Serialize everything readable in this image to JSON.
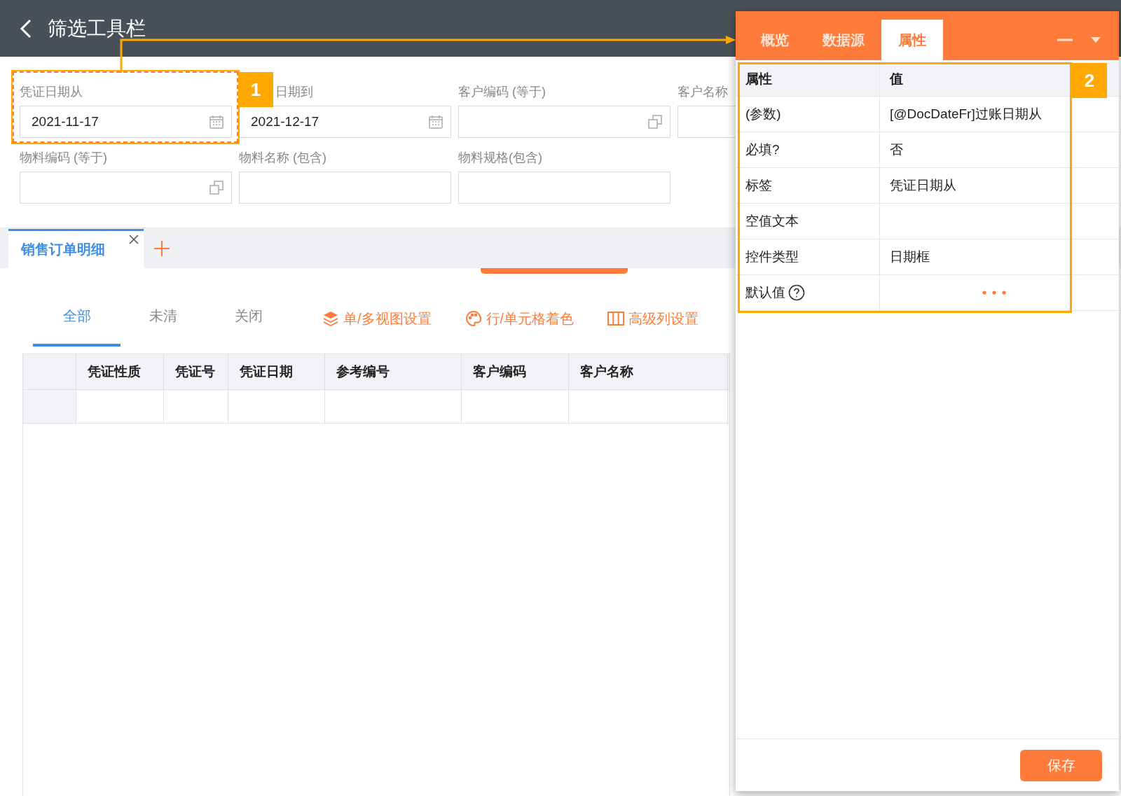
{
  "header": {
    "title": "筛选工具栏"
  },
  "filters": [
    {
      "label": "凭证日期从",
      "value": "2021-11-17",
      "kind": "date"
    },
    {
      "label": "日期到",
      "value": "2021-12-17",
      "kind": "date"
    },
    {
      "label": "客户编码 (等于)",
      "kind": "lookup"
    },
    {
      "label": "客户名称",
      "kind": "text"
    },
    {
      "label": "物料编码 (等于)",
      "kind": "lookup"
    },
    {
      "label": "物料名称 (包含)",
      "kind": "text"
    },
    {
      "label": "物料规格(包含)",
      "kind": "text"
    }
  ],
  "doc_tabs": [
    {
      "label": "销售订单明细",
      "selected": true,
      "closable": true
    }
  ],
  "view_tabs": [
    {
      "label": "全部",
      "selected": true
    },
    {
      "label": "未清",
      "selected": false
    },
    {
      "label": "关闭",
      "selected": false
    }
  ],
  "toolbar": [
    {
      "label": "单/多视图设置",
      "kind": "layers"
    },
    {
      "label": "行/单元格着色",
      "kind": "palette"
    },
    {
      "label": "高级列设置",
      "kind": "columns"
    }
  ],
  "grid": {
    "columns": [
      "凭证性质",
      "凭证号",
      "凭证日期",
      "参考编号",
      "客户编码",
      "客户名称"
    ]
  },
  "panel": {
    "tabs": [
      {
        "label": "概览",
        "selected": false
      },
      {
        "label": "数据源",
        "selected": false
      },
      {
        "label": "属性",
        "selected": true
      }
    ],
    "columns": [
      "属性",
      "值"
    ],
    "rows": [
      {
        "name": "(参数)",
        "value": "[@DocDateFr]过账日期从",
        "kind": "text"
      },
      {
        "name": "必填?",
        "value": "否",
        "kind": "text"
      },
      {
        "name": "标签",
        "value": "凭证日期从",
        "kind": "text"
      },
      {
        "name": "空值文本",
        "kind": "text"
      },
      {
        "name": "控件类型",
        "value": "日期框",
        "kind": "text"
      },
      {
        "name": "默认值",
        "kind": "picker",
        "help": true
      }
    ],
    "save": "保存"
  },
  "markers": [
    {
      "number": "1"
    },
    {
      "number": "2"
    }
  ]
}
